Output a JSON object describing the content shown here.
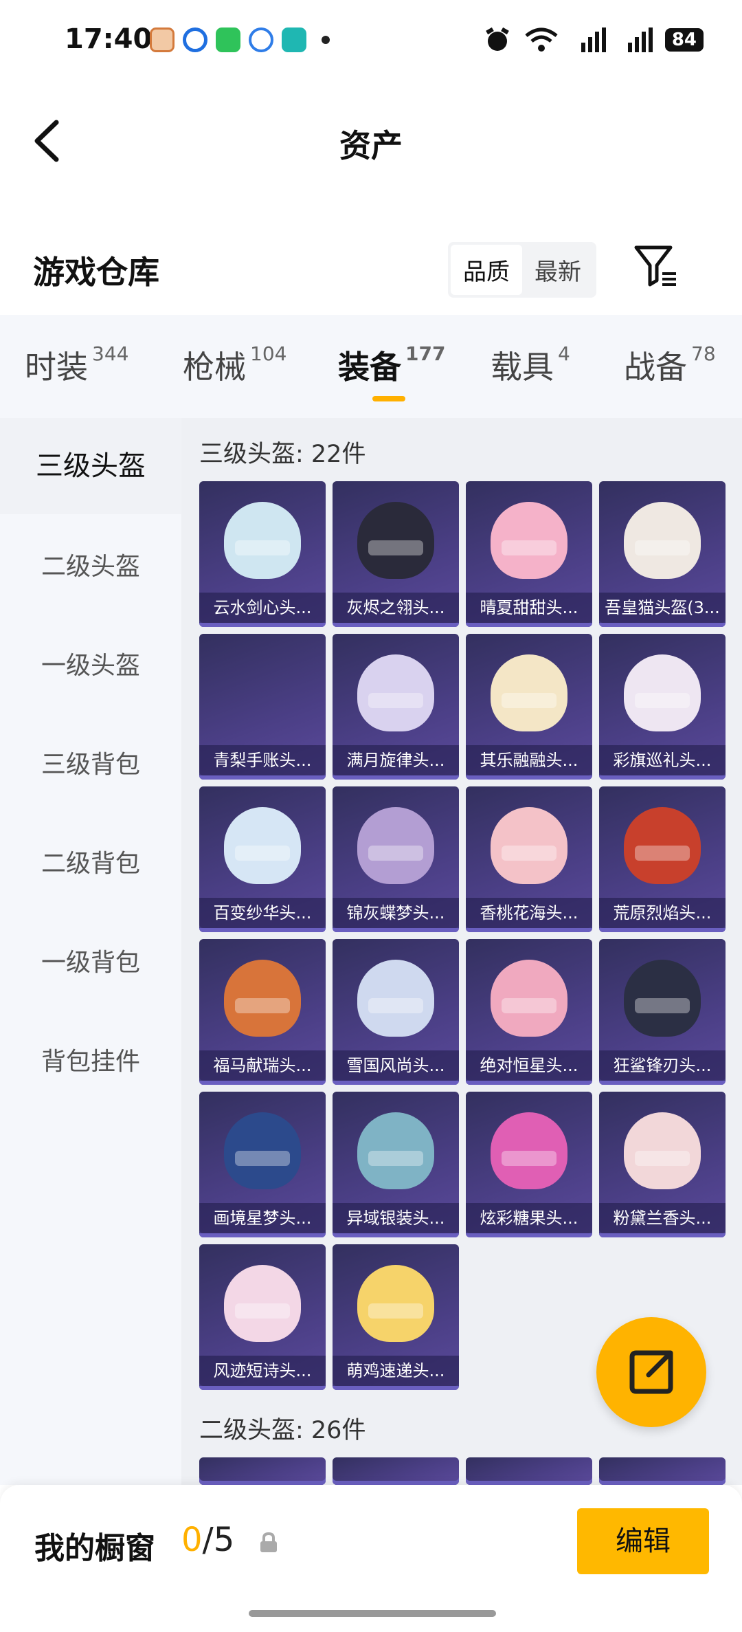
{
  "status_bar": {
    "time": "17:40",
    "battery": "84"
  },
  "header": {
    "title": "资产",
    "back_label": "back"
  },
  "warehouse": {
    "title": "游戏仓库",
    "sort_options": [
      "品质",
      "最新"
    ],
    "sort_selected": "品质"
  },
  "tabs": [
    {
      "label": "时装",
      "count": "344"
    },
    {
      "label": "枪械",
      "count": "104"
    },
    {
      "label": "装备",
      "count": "177",
      "active": true
    },
    {
      "label": "载具",
      "count": "4"
    },
    {
      "label": "战备",
      "count": "78"
    }
  ],
  "side_nav": [
    "三级头盔",
    "二级头盔",
    "一级头盔",
    "三级背包",
    "二级背包",
    "一级背包",
    "背包挂件"
  ],
  "sections": [
    {
      "title": "三级头盔: 22件"
    },
    {
      "title": "二级头盔: 26件"
    }
  ],
  "items": [
    {
      "name": "云水剑心头...",
      "color": "#cfe6f1"
    },
    {
      "name": "灰烬之翎头...",
      "color": "#2a2a3a"
    },
    {
      "name": "晴夏甜甜头...",
      "color": "#f5b2c9"
    },
    {
      "name": "吾皇猫头盔(3...",
      "color": "#efe8e2"
    },
    {
      "name": "青梨手账头...",
      "color": "#3a3766"
    },
    {
      "name": "满月旋律头...",
      "color": "#d9d2ef"
    },
    {
      "name": "其乐融融头...",
      "color": "#f4e6c6"
    },
    {
      "name": "彩旗巡礼头...",
      "color": "#eee6f2"
    },
    {
      "name": "百变纱华头...",
      "color": "#d6e6f5"
    },
    {
      "name": "锦灰蝶梦头...",
      "color": "#b39ed3"
    },
    {
      "name": "香桃花海头...",
      "color": "#f4c2c8"
    },
    {
      "name": "荒原烈焰头...",
      "color": "#c8402c"
    },
    {
      "name": "福马献瑞头...",
      "color": "#d8743a"
    },
    {
      "name": "雪国风尚头...",
      "color": "#cfd9ef"
    },
    {
      "name": "绝对恒星头...",
      "color": "#f0a9bf"
    },
    {
      "name": "狂鲨锋刃头...",
      "color": "#2b2f44"
    },
    {
      "name": "画境星梦头...",
      "color": "#2c4a8c"
    },
    {
      "name": "异域银装头...",
      "color": "#7fb3c5"
    },
    {
      "name": "炫彩糖果头...",
      "color": "#e05fb4"
    },
    {
      "name": "粉黛兰香头...",
      "color": "#f2d7d9"
    },
    {
      "name": "风迹短诗头...",
      "color": "#f3d7e6"
    },
    {
      "name": "萌鸡速递头...",
      "color": "#f6d36a"
    }
  ],
  "showcase": {
    "label": "我的橱窗",
    "current": "0",
    "total": "/5",
    "edit_label": "编辑"
  },
  "accent_color": "#ffb000"
}
